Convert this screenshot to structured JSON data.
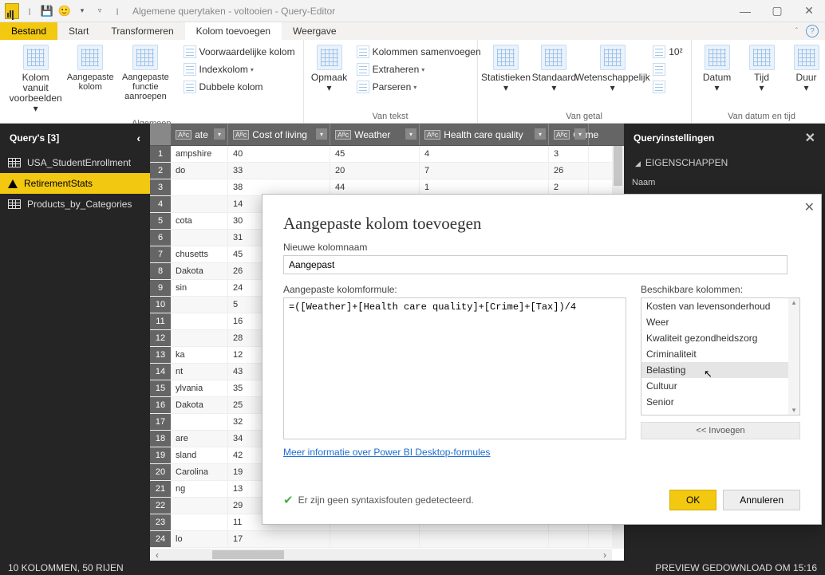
{
  "window": {
    "title": "Algemene querytaken - voltooien - Query-Editor"
  },
  "menus": {
    "file": "Bestand",
    "start": "Start",
    "transform": "Transformeren",
    "addcol": "Kolom toevoegen",
    "view": "Weergave"
  },
  "ribbon": {
    "g1": {
      "label": "Algemeen",
      "b1": "Kolom vanuit\nvoorbeelden",
      "b1d": "▾",
      "b2": "Aangepaste\nkolom",
      "b3": "Aangepaste\nfunctie aanroepen",
      "s1": "Voorwaardelijke kolom",
      "s2": "Indexkolom",
      "s2d": "▾",
      "s3": "Dubbele kolom"
    },
    "g2": {
      "label": "Van tekst",
      "b1": "Opmaak",
      "b1d": "▾",
      "s1": "Kolommen samenvoegen",
      "s2": "Extraheren",
      "s2d": "▾",
      "s3": "Parseren",
      "s3d": "▾"
    },
    "g3": {
      "label": "Van getal",
      "b1": "Statistieken",
      "b2": "Standaard",
      "b3": "Wetenschappelijk",
      "bd": "▾",
      "s1": "10²",
      "s2": "◺",
      "s3": ".00"
    },
    "g4": {
      "label": "Van datum en tijd",
      "b1": "Datum",
      "b2": "Tijd",
      "b3": "Duur",
      "bd": "▾"
    }
  },
  "sidebar": {
    "title": "Query's [3]",
    "items": [
      "USA_StudentEnrollment",
      "RetirementStats",
      "Products_by_Categories"
    ]
  },
  "columns": [
    {
      "name": "ate",
      "w": 72
    },
    {
      "name": "Cost of living",
      "w": 128
    },
    {
      "name": "Weather",
      "w": 112
    },
    {
      "name": "Health care quality",
      "w": 162
    },
    {
      "name": "Crime",
      "w": 50
    }
  ],
  "rows": [
    [
      "ampshire",
      "40",
      "45",
      "4",
      "3"
    ],
    [
      "do",
      "33",
      "20",
      "7",
      "26"
    ],
    [
      "",
      "38",
      "44",
      "1",
      "2"
    ],
    [
      "",
      "14",
      "",
      "",
      ""
    ],
    [
      "cota",
      "30",
      "",
      "",
      ""
    ],
    [
      "",
      "31",
      "",
      "",
      ""
    ],
    [
      "chusetts",
      "45",
      "",
      "",
      ""
    ],
    [
      "Dakota",
      "26",
      "",
      "",
      ""
    ],
    [
      "sin",
      "24",
      "",
      "",
      ""
    ],
    [
      "",
      "5",
      "",
      "",
      ""
    ],
    [
      "",
      "16",
      "",
      "",
      ""
    ],
    [
      "",
      "28",
      "",
      "",
      ""
    ],
    [
      "ka",
      "12",
      "",
      "",
      ""
    ],
    [
      "nt",
      "43",
      "",
      "",
      ""
    ],
    [
      "ylvania",
      "35",
      "",
      "",
      ""
    ],
    [
      "Dakota",
      "25",
      "",
      "",
      ""
    ],
    [
      "",
      "32",
      "",
      "",
      ""
    ],
    [
      "are",
      "34",
      "",
      "",
      ""
    ],
    [
      "sland",
      "42",
      "",
      "",
      ""
    ],
    [
      "Carolina",
      "19",
      "",
      "",
      ""
    ],
    [
      "ng",
      "13",
      "",
      "",
      ""
    ],
    [
      "",
      "29",
      "",
      "",
      ""
    ],
    [
      "",
      "11",
      "",
      "",
      ""
    ],
    [
      "lo",
      "17",
      "",
      "",
      ""
    ]
  ],
  "rpanel": {
    "title": "Queryinstellingen",
    "section": "EIGENSCHAPPEN",
    "naam": "Naam"
  },
  "statusbar": {
    "left": "10 KOLOMMEN, 50 RIJEN",
    "right": "PREVIEW GEDOWNLOAD OM 15:16"
  },
  "dialog": {
    "title": "Aangepaste kolom toevoegen",
    "name_label": "Nieuwe kolomnaam",
    "name_value": "Aangepast",
    "formula_label": "Aangepaste kolomformule:",
    "formula_value": "=([Weather]+[Health care quality]+[Crime]+[Tax])/4",
    "cols_label": "Beschikbare kolommen:",
    "cols": [
      "Kosten van levensonderhoud",
      "Weer",
      "Kwaliteit gezondheidszorg",
      "Criminaliteit",
      "Belasting",
      "Cultuur",
      "Senior"
    ],
    "insert": "<< Invoegen",
    "link": "Meer informatie over Power BI Desktop-formules",
    "valid": "Er zijn geen syntaxisfouten gedetecteerd.",
    "ok": "OK",
    "cancel": "Annuleren"
  }
}
